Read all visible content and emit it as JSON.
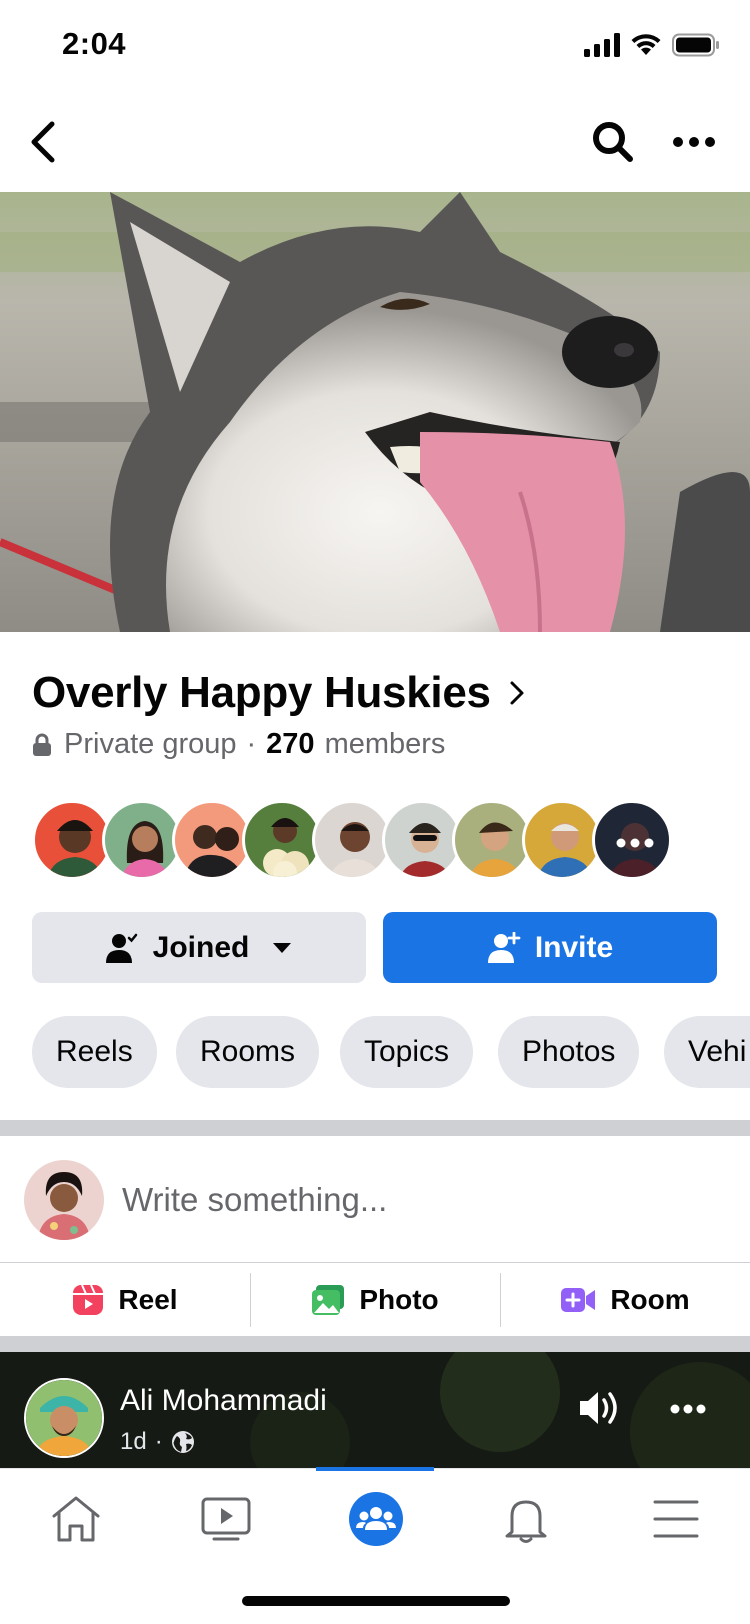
{
  "status_bar": {
    "time": "2:04"
  },
  "group": {
    "name": "Overly Happy Huskies",
    "privacy": "Private group",
    "separator": "·",
    "member_count": "270",
    "members_label": "members"
  },
  "buttons": {
    "joined": "Joined",
    "invite": "Invite"
  },
  "chips": [
    "Reels",
    "Rooms",
    "Topics",
    "Photos",
    "Vehi"
  ],
  "composer": {
    "placeholder": "Write something..."
  },
  "actions": {
    "reel": "Reel",
    "photo": "Photo",
    "room": "Room"
  },
  "post": {
    "author": "Ali Mohammadi",
    "time": "1d",
    "separator": "·"
  },
  "colors": {
    "accent": "#1b74e4",
    "secondary_bg": "#e4e6eb",
    "text_secondary": "#65676b"
  },
  "icons": {
    "nav": [
      "back-icon",
      "search-icon",
      "more-icon"
    ],
    "tabs": [
      "home-icon",
      "video-icon",
      "groups-icon",
      "bell-icon",
      "menu-icon"
    ]
  },
  "tabs": {
    "active": "groups"
  }
}
